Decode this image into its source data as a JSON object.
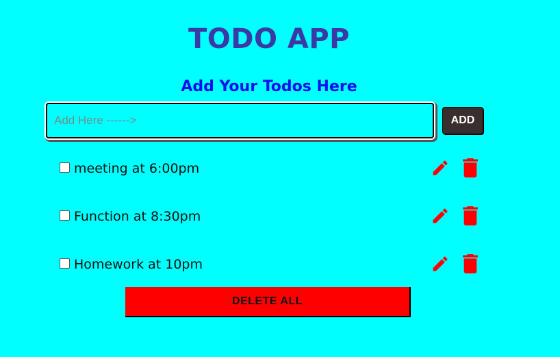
{
  "app": {
    "title": "TODO APP",
    "subtitle": "Add Your Todos Here"
  },
  "input": {
    "placeholder": "Add Here ------>",
    "value": ""
  },
  "add_button": {
    "label": "ADD"
  },
  "todos": [
    {
      "text": "meeting at 6:00pm",
      "checked": false
    },
    {
      "text": "Function at 8:30pm",
      "checked": false
    },
    {
      "text": "Homework at 10pm",
      "checked": false
    }
  ],
  "delete_all": {
    "label": "DELETE ALL"
  },
  "colors": {
    "background": "#00ffff",
    "title": "#3a3aa6",
    "subtitle": "#1010ee",
    "action_icons": "#ff0000",
    "delete_all": "#ff0000",
    "add_button": "#3a2f2f"
  },
  "icons": {
    "edit": "pencil-icon",
    "delete": "trash-icon"
  }
}
